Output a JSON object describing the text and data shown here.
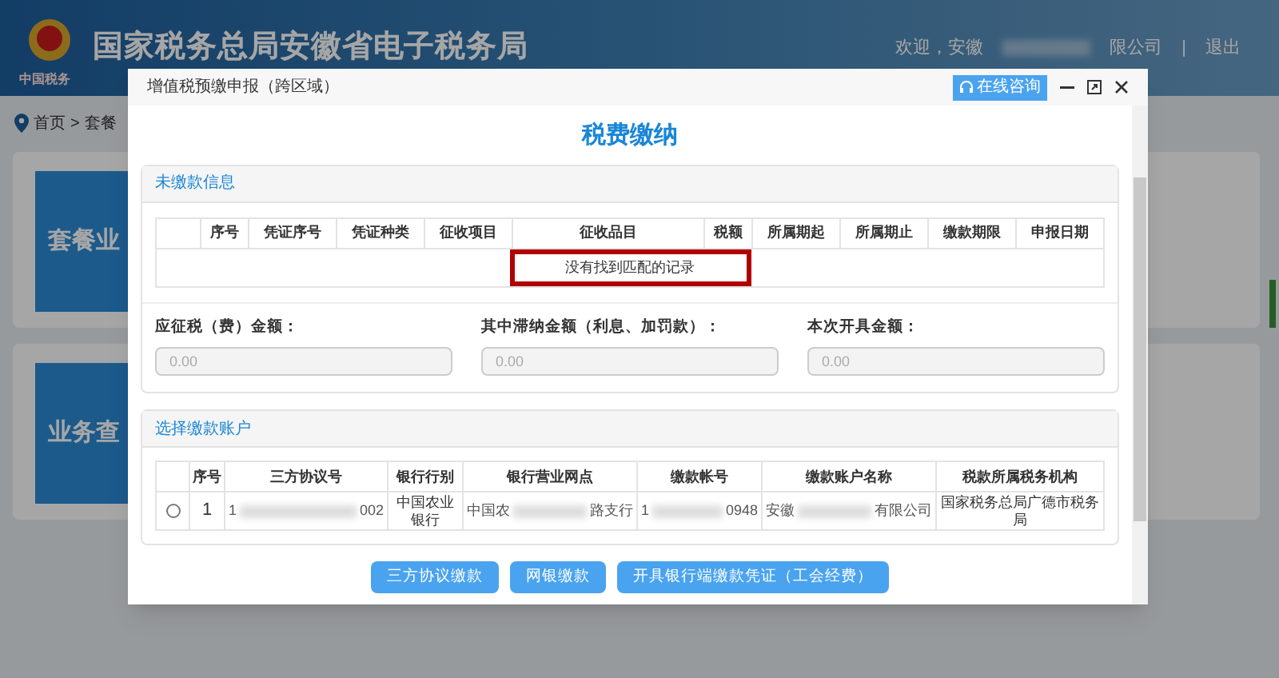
{
  "site": {
    "title": "国家税务总局安徽省电子税务局",
    "welcome": "欢迎，安徽",
    "company_tail": "限公司",
    "divider": "|",
    "logout": "退出",
    "logo_text": "中国税务"
  },
  "breadcrumb": {
    "items": [
      "首页",
      "套餐"
    ],
    "separator": ">"
  },
  "background_cards": [
    {
      "label": "套餐业"
    },
    {
      "label": "业务查"
    }
  ],
  "dialog": {
    "title": "增值税预缴申报（跨区域）",
    "consult_button": "在线咨询",
    "heading": "税费缴纳",
    "unpaid": {
      "title": "未缴款信息",
      "columns": [
        "序号",
        "凭证序号",
        "凭证种类",
        "征收项目",
        "征收品目",
        "税额",
        "所属期起",
        "所属期止",
        "缴款期限",
        "申报日期"
      ],
      "empty_message": "没有找到匹配的记录",
      "empty_highlighted": true,
      "fields": [
        {
          "label": "应征税（费）金额：",
          "placeholder": "0.00"
        },
        {
          "label": "其中滞纳金额（利息、加罚款）：",
          "placeholder": "0.00"
        },
        {
          "label": "本次开具金额：",
          "placeholder": "0.00"
        }
      ]
    },
    "accounts": {
      "title": "选择缴款账户",
      "columns": [
        "序号",
        "三方协议号",
        "银行行别",
        "银行营业网点",
        "缴款帐号",
        "缴款账户名称",
        "税款所属税务机构"
      ],
      "rows": [
        {
          "selected": false,
          "cells": [
            {
              "text": "1"
            },
            {
              "start": "1",
              "end": "002",
              "redacted": true
            },
            {
              "text": "中国农业银行"
            },
            {
              "start": "中国农",
              "end": "路支行",
              "redacted": true
            },
            {
              "start": "1",
              "end": "0948",
              "redacted": true
            },
            {
              "start": "安徽",
              "end": "有限公司",
              "redacted": true
            },
            {
              "text": "国家税务总局广德市税务局"
            }
          ]
        }
      ]
    },
    "buttons": [
      "三方协议缴款",
      "网银缴款",
      "开具银行端缴款凭证（工会经费）"
    ]
  }
}
